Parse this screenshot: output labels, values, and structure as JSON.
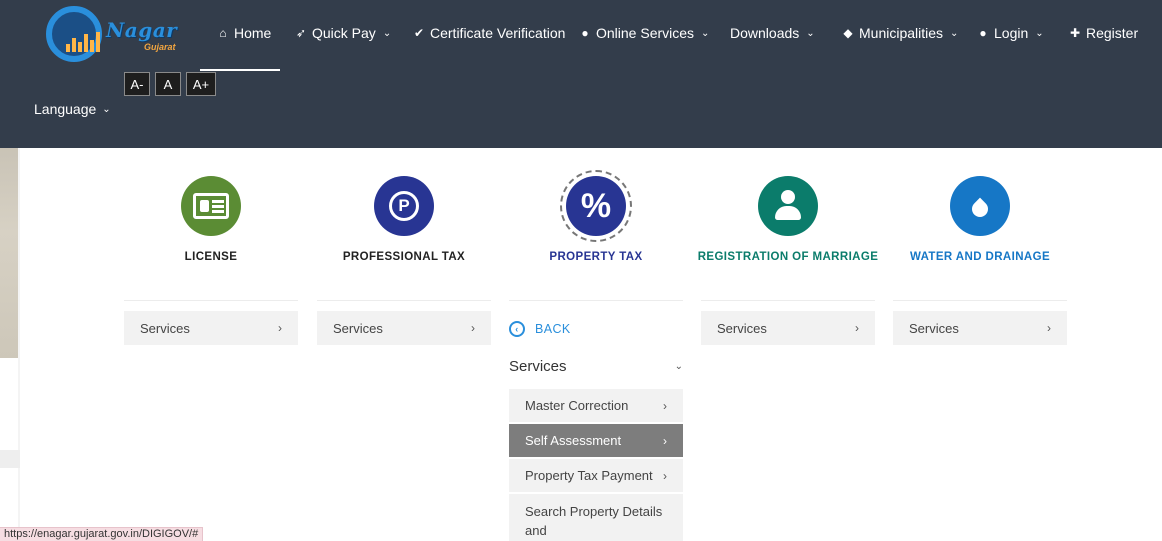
{
  "logo": {
    "title": "Nagar",
    "subtitle": "Gujarat"
  },
  "nav": {
    "home": "Home",
    "quick_pay": "Quick Pay",
    "certificate_verification": "Certificate Verification",
    "online_services": "Online Services",
    "downloads": "Downloads",
    "municipalities": "Municipalities",
    "login": "Login",
    "register": "Register"
  },
  "font_controls": {
    "decrease": "A-",
    "normal": "A",
    "increase": "A+"
  },
  "language": {
    "label": "Language"
  },
  "services": {
    "license": {
      "title": "LICENSE",
      "button": "Services",
      "color": "#5b8c34"
    },
    "professional_tax": {
      "title": "PROFESSIONAL TAX",
      "button": "Services",
      "color": "#283593"
    },
    "property_tax": {
      "title": "PROPERTY TAX",
      "color": "#283593",
      "back": "BACK",
      "section": "Services",
      "items": [
        {
          "label": "Master Correction"
        },
        {
          "label": "Self Assessment"
        },
        {
          "label": "Property Tax Payment"
        },
        {
          "label": "Search Property Details and"
        }
      ]
    },
    "marriage": {
      "title": "REGISTRATION OF MARRIAGE",
      "button": "Services",
      "color": "#0b7c6b"
    },
    "water": {
      "title": "WATER AND DRAINAGE",
      "button": "Services",
      "color": "#1677c6"
    }
  },
  "status_url": "https://enagar.gujarat.gov.in/DIGIGOV/#"
}
